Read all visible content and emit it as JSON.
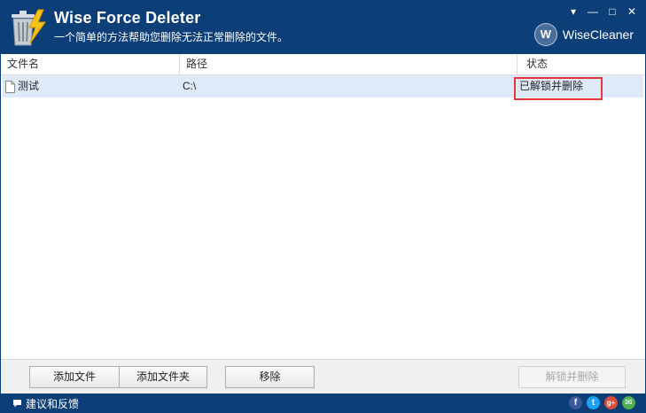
{
  "app": {
    "title": "Wise Force Deleter",
    "subtitle": "一个简单的方法帮助您删除无法正常删除的文件。",
    "brand": "WiseCleaner",
    "brand_letter": "W"
  },
  "window_controls": {
    "menu": "▾",
    "minimize": "—",
    "maximize": "□",
    "close": "✕"
  },
  "table": {
    "columns": [
      "文件名",
      "路径",
      "状态"
    ],
    "rows": [
      {
        "name": "测试",
        "path": "C:\\",
        "status": "已解锁并删除"
      }
    ]
  },
  "buttons": {
    "add_file": "添加文件",
    "add_folder": "添加文件夹",
    "remove": "移除",
    "unlock_delete": "解锁并删除"
  },
  "footer": {
    "feedback": "建议和反馈",
    "social": [
      {
        "icon": "facebook-icon",
        "glyph": "f",
        "color": "#3b5998"
      },
      {
        "icon": "twitter-icon",
        "glyph": "t",
        "color": "#1da1f2"
      },
      {
        "icon": "google-plus-icon",
        "glyph": "g+",
        "color": "#dd4b39"
      },
      {
        "icon": "email-icon",
        "glyph": "✉",
        "color": "#4caf50"
      }
    ]
  },
  "colors": {
    "titlebar": "#0c3e78",
    "row_selected": "#dfeaf8",
    "highlight_border": "#e8333a"
  }
}
